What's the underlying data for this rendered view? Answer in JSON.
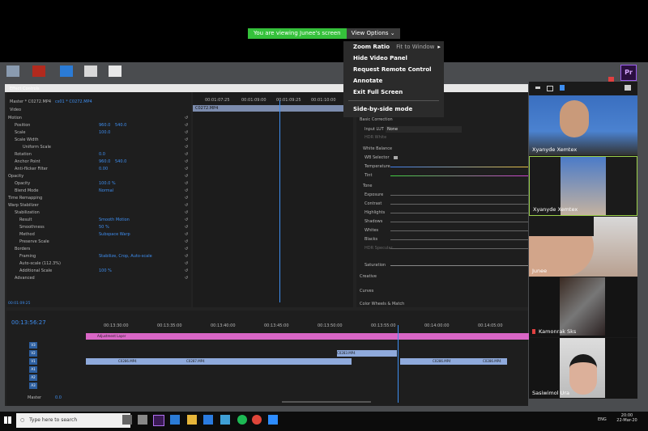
{
  "zoom_banner": {
    "viewing_text": "You are viewing Junee's screen",
    "view_options_label": "View Options"
  },
  "view_menu": {
    "items": [
      {
        "label": "Zoom Ratio",
        "sub": "Fit to Window"
      },
      {
        "label": "Hide Video Panel"
      },
      {
        "label": "Request Remote Control"
      },
      {
        "label": "Annotate"
      },
      {
        "label": "Exit Full Screen"
      },
      {
        "label": "Side-by-side mode"
      }
    ]
  },
  "premiere": {
    "effect_controls_title": "Effect Controls",
    "master_clip": "Master * C0272.MP4",
    "active_clip": "cs01 * C0272.MP4",
    "clip_label": "C0272.MP4",
    "source_timecodes": [
      "00:01:07:25",
      "00:01:09:00",
      "00:01:09:25",
      "00:01:10:00"
    ],
    "video_label": "Video",
    "props": [
      {
        "name": "Motion"
      },
      {
        "name": "Position",
        "value": "960.0",
        "value2": "540.0"
      },
      {
        "name": "Scale",
        "value": "100.0"
      },
      {
        "name": "Scale Width"
      },
      {
        "name": "Uniform Scale"
      },
      {
        "name": "Rotation",
        "value": "0.0"
      },
      {
        "name": "Anchor Point",
        "value": "960.0",
        "value2": "540.0"
      },
      {
        "name": "Anti-flicker Filter",
        "value": "0.00"
      },
      {
        "name": "Opacity"
      },
      {
        "name": "Opacity",
        "value": "100.0 %"
      },
      {
        "name": "Blend Mode",
        "value": "Normal"
      },
      {
        "name": "Time Remapping"
      },
      {
        "name": "Warp Stabilizer"
      },
      {
        "name": "Stabilization"
      },
      {
        "name": "Result",
        "value": "Smooth Motion"
      },
      {
        "name": "Smoothness",
        "value": "50 %"
      },
      {
        "name": "Method",
        "value": "Subspace Warp"
      },
      {
        "name": "Preserve Scale"
      },
      {
        "name": "Borders"
      },
      {
        "name": "Framing",
        "value": "Stabilize, Crop, Auto-scale"
      },
      {
        "name": "Auto-scale (112.3%)"
      },
      {
        "name": "Additional Scale",
        "value": "100 %"
      },
      {
        "name": "Advanced"
      }
    ],
    "effects_timecode": "00:01:09:25",
    "lumetri": {
      "basic_correction": "Basic Correction",
      "input_lut_label": "Input LUT",
      "input_lut_value": "None",
      "hdr_white": "HDR White",
      "white_balance": "White Balance",
      "wb_selector": "WB Selector",
      "temperature": "Temperature",
      "tint": "Tint",
      "tone": "Tone",
      "tone_items": [
        "Exposure",
        "Contrast",
        "Highlights",
        "Shadows",
        "Whites",
        "Blacks",
        "HDR Specular"
      ],
      "saturation": "Saturation",
      "creative": "Creative",
      "curves": "Curves",
      "color_wheels": "Color Wheels & Match"
    },
    "timeline": {
      "timecode": "00:13:56:27",
      "ruler": [
        "00:13:30:00",
        "00:13:35:00",
        "00:13:40:00",
        "00:13:45:00",
        "00:13:50:00",
        "00:13:55:00",
        "00:14:00:00",
        "00:14:05:00"
      ],
      "tracks_v": [
        "V3",
        "V2",
        "V1"
      ],
      "tracks_a": [
        "A1",
        "A2",
        "A3"
      ],
      "master_label": "Master",
      "master_value": "0.0",
      "adjustment_clip": "Adjustment Layer",
      "top_clip": "C0283.MP4",
      "v1_clips": [
        "C0286.MP4",
        "C0287.MP4",
        "C028",
        "C0286.MP4",
        "C0286.MP4"
      ]
    }
  },
  "participants": [
    {
      "name": "Xyanyde Xemtex"
    },
    {
      "name": "Xyanyde Xemtex"
    },
    {
      "name": "Junee"
    },
    {
      "name": "Kamonrak Sks"
    },
    {
      "name": "Sasiwimol Ura"
    }
  ],
  "taskbar": {
    "search_placeholder": "Type here to search",
    "lang": "ENG",
    "time": "20:00",
    "date": "22-Mar-20"
  }
}
